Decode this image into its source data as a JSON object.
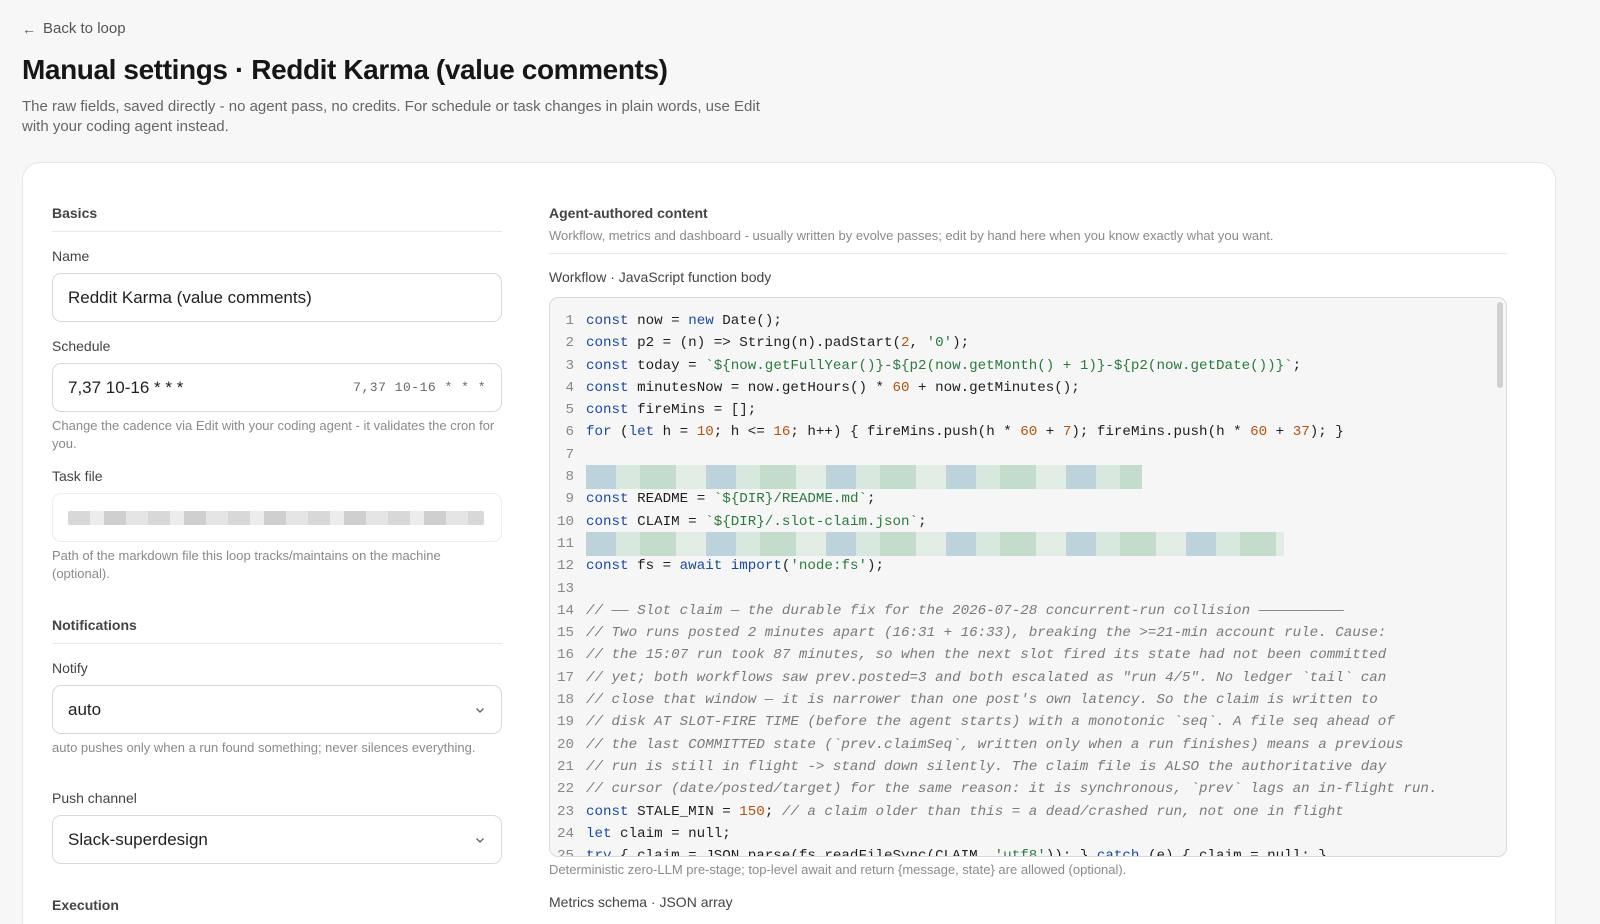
{
  "back_link": {
    "label": "Back to loop"
  },
  "page": {
    "title": "Manual settings · Reddit Karma (value comments)",
    "subtitle": "The raw fields, saved directly - no agent pass, no credits. For schedule or task changes in plain words, use Edit with your coding agent instead."
  },
  "basics": {
    "heading": "Basics",
    "name_label": "Name",
    "name_value": "Reddit Karma (value comments)",
    "schedule_label": "Schedule",
    "schedule_value": "7,37 10-16 * * *",
    "schedule_preview": "7,37 10-16 * * *",
    "schedule_help": "Change the cadence via Edit with your coding agent - it validates the cron for you.",
    "task_file_label": "Task file",
    "task_file_help": "Path of the markdown file this loop tracks/maintains on the machine (optional)."
  },
  "notifications": {
    "heading": "Notifications",
    "notify_label": "Notify",
    "notify_value": "auto",
    "notify_help": "auto pushes only when a run found something; never silences everything.",
    "push_label": "Push channel",
    "push_value": "Slack-superdesign"
  },
  "execution": {
    "heading": "Execution"
  },
  "agent_content": {
    "heading": "Agent-authored content",
    "description": "Workflow, metrics and dashboard - usually written by evolve passes; edit by hand here when you know exactly what you want.",
    "workflow_label": "Workflow · JavaScript function body",
    "workflow_help": "Deterministic zero-LLM pre-stage; top-level await and return {message, state} are allowed (optional).",
    "metrics_label": "Metrics schema · JSON array"
  },
  "code": {
    "line_numbers": [
      "1",
      "2",
      "3",
      "4",
      "5",
      "6",
      "7",
      "8",
      "9",
      "10",
      "11",
      "12",
      "13",
      "14",
      "15",
      "16",
      "17",
      "18",
      "19",
      "20",
      "21",
      "22",
      "23",
      "24",
      "25"
    ],
    "lines": [
      "const now = new Date();",
      "const p2 = (n) => String(n).padStart(2, '0');",
      "const today = `${now.getFullYear()}-${p2(now.getMonth() + 1)}-${p2(now.getDate())}`;",
      "const minutesNow = now.getHours() * 60 + now.getMinutes();",
      "const fireMins = [];",
      "for (let h = 10; h <= 16; h++) { fireMins.push(h * 60 + 7); fireMins.push(h * 60 + 37); }",
      "",
      "",
      "const README = `${DIR}/README.md`;",
      "const CLAIM = `${DIR}/.slot-claim.json`;",
      "",
      "const fs = await import('node:fs');",
      "",
      "// —— Slot claim — the durable fix for the 2026-07-28 concurrent-run collision ——————————",
      "// Two runs posted 2 minutes apart (16:31 + 16:33), breaking the >=21-min account rule. Cause:",
      "// the 15:07 run took 87 minutes, so when the next slot fired its state had not been committed",
      "// yet; both workflows saw prev.posted=3 and both escalated as \"run 4/5\". No ledger `tail` can",
      "// close that window — it is narrower than one post's own latency. So the claim is written to",
      "// disk AT SLOT-FIRE TIME (before the agent starts) with a monotonic `seq`. A file seq ahead of",
      "// the last COMMITTED state (`prev.claimSeq`, written only when a run finishes) means a previous",
      "// run is still in flight -> stand down silently. The claim file is ALSO the authoritative day",
      "// cursor (date/posted/target) for the same reason: it is synchronous, `prev` lags an in-flight run.",
      "const STALE_MIN = 150; // a claim older than this = a dead/crashed run, not one in flight",
      "let claim = null;",
      "try { claim = JSON.parse(fs.readFileSync(CLAIM, 'utf8')); } catch (e) { claim = null; }"
    ]
  }
}
